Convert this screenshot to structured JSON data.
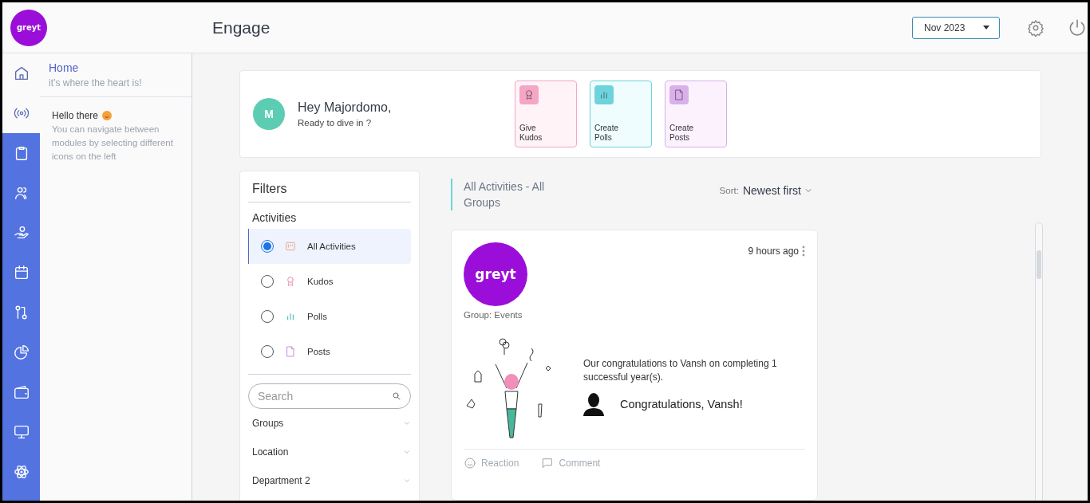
{
  "header": {
    "logo": "greyt",
    "title": "Engage",
    "month": "Nov 2023"
  },
  "nav": {
    "home": {
      "title": "Home",
      "subtitle": "it’s where the heart is!"
    },
    "hint": {
      "title": "Hello there",
      "text": "You can navigate between modules by selecting different icons on the left"
    }
  },
  "greeting": {
    "avatar": "M",
    "title": "Hey Majordomo,",
    "subtitle": "Ready to dive in ?"
  },
  "quick_actions": [
    {
      "kind": "kudos",
      "label": "Give Kudos",
      "color": "#f4a6c4"
    },
    {
      "kind": "polls",
      "label": "Create Polls",
      "color": "#6fd3dc"
    },
    {
      "kind": "posts",
      "label": "Create Posts",
      "color": "#d9b0ea"
    }
  ],
  "filters": {
    "title": "Filters",
    "section": "Activities",
    "options": [
      {
        "kind": "all",
        "label": "All Activities",
        "selected": true
      },
      {
        "kind": "kudos",
        "label": "Kudos",
        "selected": false
      },
      {
        "kind": "polls",
        "label": "Polls",
        "selected": false
      },
      {
        "kind": "posts",
        "label": "Posts",
        "selected": false
      }
    ],
    "search": {
      "placeholder": "Search"
    },
    "dropdowns": [
      "Groups",
      "Location",
      "Department 2"
    ]
  },
  "feed": {
    "heading": "All Activities - All Groups",
    "sort_label": "Sort:",
    "sort_value": "Newest first",
    "post": {
      "logo": "greyt",
      "time": "9 hours ago",
      "group": "Group: Events",
      "message": "Our congratulations to Vansh on completing 1 successful year(s).",
      "headline": "Congratulations, Vansh!",
      "actions": [
        {
          "kind": "reaction",
          "label": "Reaction"
        },
        {
          "kind": "comment",
          "label": "Comment"
        }
      ]
    }
  }
}
